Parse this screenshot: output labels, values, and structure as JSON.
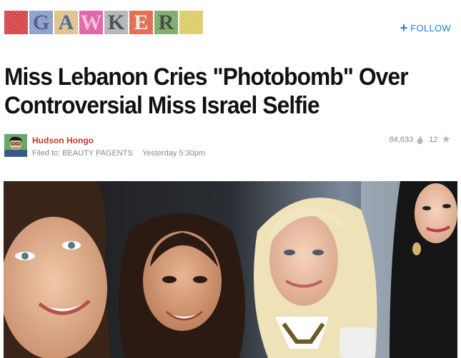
{
  "site": {
    "logo_letters": [
      "",
      "G",
      "A",
      "W",
      "K",
      "E",
      "R",
      ""
    ],
    "logo_tile_colors": [
      "#d9474c",
      "#8fa2cc",
      "#e8c58e",
      "#e85fa8",
      "#b8b8b8",
      "#e86a4a",
      "#7fae6a",
      "#e0d36a"
    ],
    "logo_letter_colors": [
      "#d9474c",
      "#4a5a8c",
      "#3a6a9a",
      "#f7c3e0",
      "#3f4a4a",
      "#f2f2f2",
      "#3a4a3a",
      "#e0d36a"
    ]
  },
  "header": {
    "follow_label": "FOLLOW",
    "follow_icon": "plus-icon"
  },
  "article": {
    "title": "Miss Lebanon Cries \"Photobomb\" Over Controversial Miss Israel Selfie",
    "author": "Hudson Hongo",
    "filed_to": "Filed to: BEAUTY PAGENTS",
    "time": "Yesterday 5:30pm",
    "views": "84,633",
    "stars": "12"
  },
  "colors": {
    "accent": "#1c7ed6",
    "author": "#c0392b"
  }
}
